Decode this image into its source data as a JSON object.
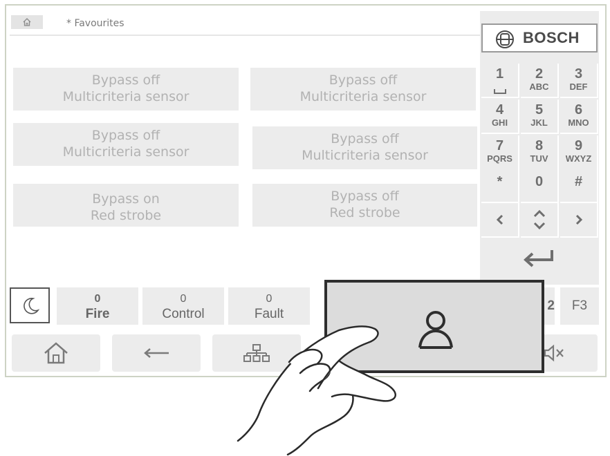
{
  "header": {
    "home_icon": "home-icon",
    "title": "* Favourites"
  },
  "tiles": [
    {
      "line1": "Bypass off",
      "line2": "Multicriteria sensor"
    },
    {
      "line1": "Bypass off",
      "line2": "Multicriteria sensor"
    },
    {
      "line1": "Bypass off",
      "line2": "Multicriteria sensor"
    },
    {
      "line1": "Bypass off",
      "line2": "Multicriteria sensor"
    },
    {
      "line1": "Bypass on",
      "line2": "Red strobe"
    },
    {
      "line1": "Bypass off",
      "line2": "Red strobe"
    }
  ],
  "brand": {
    "logo_text": "BOSCH"
  },
  "keypad": {
    "keys": [
      {
        "num": "1",
        "sub": "␣"
      },
      {
        "num": "2",
        "sub": "ABC"
      },
      {
        "num": "3",
        "sub": "DEF"
      },
      {
        "num": "4",
        "sub": "GHI"
      },
      {
        "num": "5",
        "sub": "JKL"
      },
      {
        "num": "6",
        "sub": "MNO"
      },
      {
        "num": "7",
        "sub": "PQRS"
      },
      {
        "num": "8",
        "sub": "TUV"
      },
      {
        "num": "9",
        "sub": "WXYZ"
      },
      {
        "num": "*",
        "sub": ""
      },
      {
        "num": "0",
        "sub": ""
      },
      {
        "num": "#",
        "sub": ""
      }
    ],
    "arrows": [
      "chevron-left-icon",
      "up-down-icon",
      "chevron-right-icon"
    ],
    "enter_icon": "enter-icon"
  },
  "status": {
    "counters": [
      {
        "count": "0",
        "label": "Fire"
      },
      {
        "count": "0",
        "label": "Control"
      },
      {
        "count": "0",
        "label": "Fault"
      }
    ],
    "f2_partial": "2",
    "f3": "F3"
  },
  "navbar": {
    "icons": [
      "home-icon",
      "back-arrow-icon",
      "element-tree-icon",
      "mute-icon"
    ]
  },
  "popup": {
    "icon": "user-icon"
  },
  "colors": {
    "tile_bg": "#ececec",
    "tile_text": "#b2b2b2",
    "frame": "#cdd3c4",
    "popup_border": "#2e2e2e"
  }
}
